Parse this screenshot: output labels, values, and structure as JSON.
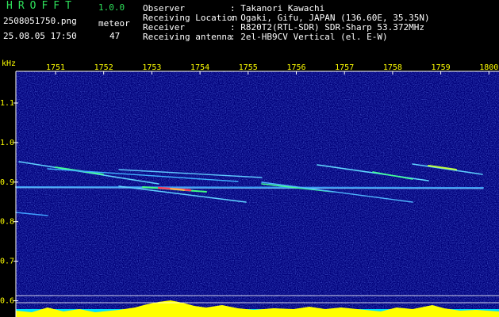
{
  "header": {
    "app_title": "HROFFT",
    "app_version": "1.0.0",
    "filename": "2508051750.png",
    "timestamp": "25.08.05 17:50",
    "meteor_label": "meteor",
    "meteor_count": "47"
  },
  "info": [
    {
      "label": "Observer",
      "value": ": Takanori Kawachi"
    },
    {
      "label": "Receiving Location",
      "value": ": Ogaki, Gifu, JAPAN (136.60E, 35.35N)"
    },
    {
      "label": "Receiver",
      "value": ": R820T2(RTL-SDR) SDR-Sharp 53.372MHz"
    },
    {
      "label": "Receiving antenna",
      "value": ": 2el-HB9CV Vertical (el. E-W)"
    }
  ],
  "spectrogram": {
    "unit_label": "kHz",
    "time_ticks": [
      "1751",
      "1752",
      "1753",
      "1754",
      "1755",
      "1756",
      "1757",
      "1758",
      "1759",
      "1800"
    ],
    "freq_ticks": [
      "1.1",
      "1.0",
      "0.9",
      "0.8",
      "0.7",
      "0.6"
    ],
    "colors": {
      "background": "#00007a",
      "axis": "#ffffff",
      "tick_text": "#ffff00",
      "strip_yellow": "#ffff00",
      "strip_cyan": "#00e0ff"
    }
  }
}
